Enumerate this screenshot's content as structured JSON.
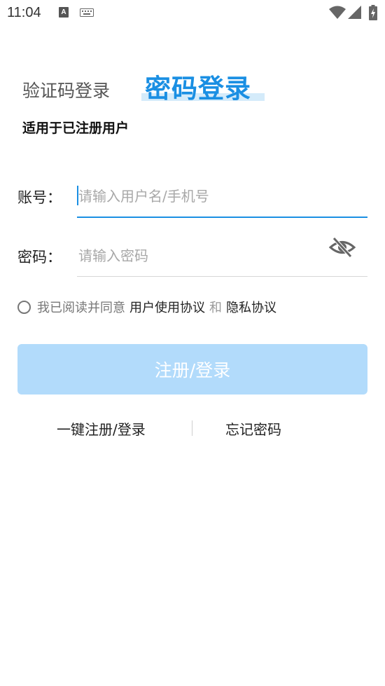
{
  "status_bar": {
    "time": "11:04",
    "notification_letter": "A"
  },
  "tabs": {
    "sms_login": "验证码登录",
    "password_login": "密码登录"
  },
  "subtitle": "适用于已注册用户",
  "account": {
    "label": "账号：",
    "placeholder": "请输入用户名/手机号",
    "value": ""
  },
  "password": {
    "label": "密码：",
    "placeholder": "请输入密码",
    "value": ""
  },
  "agreement": {
    "prefix": "我已阅读并同意",
    "user_agreement": "用户使用协议",
    "conjunction": "和",
    "privacy_policy": "隐私协议",
    "checked": false
  },
  "submit_label": "注册/登录",
  "links": {
    "one_key": "一键注册/登录",
    "forgot_password": "忘记密码"
  },
  "colors": {
    "accent": "#1a8fe3",
    "tab_underline": "#d4ebfa",
    "button_disabled": "#b2dbfb",
    "placeholder": "#a8a8a8"
  },
  "icons": {
    "eye": "eye-off-icon",
    "wifi": "wifi-icon",
    "signal": "signal-icon",
    "battery": "battery-charging-icon",
    "keyboard": "keyboard-icon"
  }
}
